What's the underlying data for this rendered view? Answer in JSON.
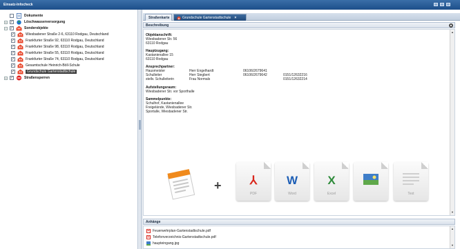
{
  "window": {
    "title": "Einsatz-Infocheck"
  },
  "tree": {
    "items": [
      {
        "label": "Dokumente",
        "bold": true,
        "expander": "",
        "checked": false,
        "icon": "document-icon"
      },
      {
        "label": "Löschwasserversorgung",
        "bold": true,
        "expander": "+",
        "checked": true,
        "icon": "hydrant-icon"
      },
      {
        "label": "Sonderobjekte",
        "bold": true,
        "expander": "−",
        "checked": true,
        "icon": "building-icon"
      },
      {
        "label": "Wiesbadener Straße 2-6, 63110 Rodgau, Deutschland",
        "bold": false,
        "expander": "",
        "checked": true,
        "icon": "building-icon"
      },
      {
        "label": "Frankfurter Straße 92, 63110 Rodgau, Deutschland",
        "bold": false,
        "expander": "",
        "checked": true,
        "icon": "building-icon"
      },
      {
        "label": "Frankfurter Straße 98, 63110 Rodgau, Deutschland",
        "bold": false,
        "expander": "",
        "checked": true,
        "icon": "building-icon"
      },
      {
        "label": "Frankfurter Straße 55, 63110 Rodgau, Deutschland",
        "bold": false,
        "expander": "",
        "checked": true,
        "icon": "building-icon"
      },
      {
        "label": "Frankfurter Straße 74, 63110 Rodgau, Deutschland",
        "bold": false,
        "expander": "",
        "checked": true,
        "icon": "building-icon"
      },
      {
        "label": "Gesamtschule Heinrich-Böll-Schule",
        "bold": false,
        "expander": "",
        "checked": true,
        "icon": "building-icon"
      },
      {
        "label": "Grundschule Gartenstadtschule",
        "bold": false,
        "expander": "",
        "checked": true,
        "icon": "building-icon",
        "selected": true
      },
      {
        "label": "Straßensperren",
        "bold": true,
        "expander": "+",
        "checked": true,
        "icon": "roadblock-icon"
      }
    ]
  },
  "tabs": {
    "map": "Straßenkarte",
    "object": "Grundschule Gartenstadtschule",
    "close": "×"
  },
  "description": {
    "header": "Beschreibung",
    "object_address_label": "Objektanschrift:",
    "object_address": [
      "Wiesbadener Str. 56",
      "63110 Rodgau"
    ],
    "main_entrance_label": "Hauptzugang:",
    "main_entrance": [
      "Kastanienallee 15",
      "63110 Rodgau"
    ],
    "contacts_label": "Ansprechpartner:",
    "contacts": [
      {
        "role": "Hausmeister",
        "name": "Herr Engelhardt",
        "phone": "06106/2679641",
        "mobile": ""
      },
      {
        "role": "Schulleiter",
        "name": "Herr Siegbert",
        "phone": "06106/2679642",
        "mobile": "0151/12632216"
      },
      {
        "role": "stellv. Schulleiterin",
        "name": "Frau Normals",
        "phone": "",
        "mobile": "0151/12632214"
      }
    ],
    "assembly_label": "Aufstellungsraum:",
    "assembly": [
      "Wiesbadener Str. vor Sporthalle"
    ],
    "collection_label": "Sammelpunkte:",
    "collection": [
      "Schulhof, Kastanienallee",
      "Freigelände, Wiesbadener Str.",
      "Sportalle, Wiesbadener Str."
    ]
  },
  "export": {
    "plus": "+",
    "formats": [
      {
        "label": "PDF",
        "glyph": "⅄",
        "color": "#d9261c",
        "icon": "pdf-icon"
      },
      {
        "label": "Word",
        "glyph": "W",
        "color": "#1d5eb5",
        "icon": "word-icon"
      },
      {
        "label": "Excel",
        "glyph": "X",
        "color": "#2e8b3a",
        "icon": "excel-icon"
      },
      {
        "label": "",
        "glyph": "",
        "color": "#3f7ec9",
        "icon": "image-icon"
      },
      {
        "label": "Text",
        "glyph": "",
        "color": "#888888",
        "icon": "text-file-icon"
      }
    ]
  },
  "attachments": {
    "header": "Anhänge",
    "files": [
      {
        "name": "Feuerwehrplan-Gartenstadtschule.pdf",
        "icon": "pdf-icon",
        "color": "#d9261c"
      },
      {
        "name": "Telefonverzeichnis-Gartenstadtschule.pdf",
        "icon": "pdf-icon",
        "color": "#d9261c"
      },
      {
        "name": "haupteingang.jpg",
        "icon": "image-icon",
        "color": "#3f7ec9"
      }
    ]
  }
}
